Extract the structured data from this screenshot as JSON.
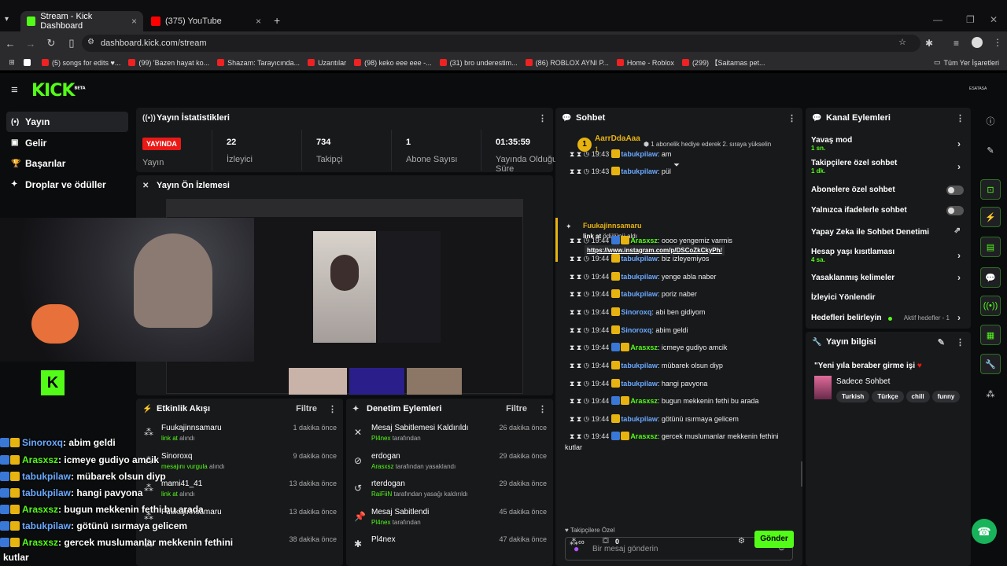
{
  "browser": {
    "tabs": [
      {
        "label": "Stream - Kick Dashboard",
        "color": "#53fc18"
      },
      {
        "label": "(375) YouTube",
        "color": "#ff0000"
      }
    ],
    "url": "dashboard.kick.com/stream",
    "bookmarks": [
      "(5) songs for edits ♥...",
      "(99) 'Bazen hayat ko...",
      "Shazam: Tarayıcında...",
      "Uzantılar",
      "(98) keko eee eee -...",
      "(31) bro underestim...",
      "(86) ROBLOX AYNI P...",
      "Home - Roblox",
      "(299) 【Saitamas pet..."
    ],
    "all_bookmarks": "Tüm Yer İşaretleri"
  },
  "kick": {
    "logo": "KICK",
    "beta": "BETA",
    "avatar_label": "ESATASA"
  },
  "sidebar": {
    "items": [
      {
        "label": "Yayın",
        "icon": "(•)"
      },
      {
        "label": "Gelir",
        "icon": "▣"
      },
      {
        "label": "Başarılar",
        "icon": "🏆"
      },
      {
        "label": "Droplar ve ödüller",
        "icon": "✦"
      }
    ]
  },
  "stats": {
    "title": "Yayın İstatistikleri",
    "live_badge": "YAYINDA",
    "live_label": "Yayın",
    "items": [
      {
        "value": "22",
        "label": "İzleyici"
      },
      {
        "value": "734",
        "label": "Takipçi"
      },
      {
        "value": "1",
        "label": "Abone Sayısı"
      },
      {
        "value": "01:35:59",
        "label": "Yayında Olduğu Süre"
      }
    ]
  },
  "preview": {
    "title": "Yayın Ön İzlemesi"
  },
  "activity": {
    "title": "Etkinlik Akışı",
    "filter": "Filtre",
    "items": [
      {
        "name": "Fuukajinnsamaru",
        "action": "link at",
        "suffix": "alındı",
        "time": "1 dakika önce"
      },
      {
        "name": "Sinoroxq",
        "action": "mesajını vurgula",
        "suffix": "alındı",
        "time": "9 dakika önce"
      },
      {
        "name": "mami41_41",
        "action": "link at",
        "suffix": "alındı",
        "time": "13 dakika önce"
      },
      {
        "name": "Fuukajinnsamaru",
        "action": "",
        "suffix": "",
        "time": "13 dakika önce"
      },
      {
        "name": "",
        "action": "",
        "suffix": "",
        "time": "38 dakika önce"
      }
    ]
  },
  "moderation": {
    "title": "Denetim Eylemleri",
    "filter": "Filtre",
    "items": [
      {
        "name": "Mesaj Sabitlemesi Kaldırıldı",
        "by": "Pl4nex",
        "suffix": "tarafından",
        "time": "26 dakika önce",
        "icon": "✕"
      },
      {
        "name": "erdogan",
        "by": "Arasxsz",
        "suffix": "tarafından yasaklandı",
        "time": "29 dakika önce",
        "icon": "⊘"
      },
      {
        "name": "rterdogan",
        "by": "RaiFiiN",
        "suffix": "tarafından yasağı kaldırıldı",
        "time": "29 dakika önce",
        "icon": "↺"
      },
      {
        "name": "Mesaj Sabitlendi",
        "by": "Pl4nex",
        "suffix": "tarafından",
        "time": "45 dakika önce",
        "icon": "📌"
      },
      {
        "name": "Pl4nex",
        "by": "",
        "suffix": "",
        "time": "47 dakika önce",
        "icon": "✱"
      }
    ]
  },
  "chat": {
    "title": "Sohbet",
    "gifter": {
      "name": "AarrDdaAaa",
      "count": "1",
      "rank": "1"
    },
    "gift_text": "1 abonelik hediye ederek 2. sıraya yükselin",
    "pinned": {
      "user": "Fuukajinnsamaru",
      "text_bold": "link at",
      "text": "ödülünü aldı",
      "link": "https://www.instagram.com/p/DSCoZkCkyPh/"
    },
    "messages": [
      {
        "time": "19:43",
        "user": "tabukpilaw",
        "color": "#6aa9ff",
        "text": "am"
      },
      {
        "time": "19:43",
        "user": "tabukpilaw",
        "color": "#6aa9ff",
        "text": "pül"
      },
      {
        "time": "19:44",
        "user": "Arasxsz",
        "color": "#53fc18",
        "text": "oooo yengemiz varmis"
      },
      {
        "time": "19:44",
        "user": "tabukpilaw",
        "color": "#6aa9ff",
        "text": "biz izleyemiyos"
      },
      {
        "time": "19:44",
        "user": "tabukpilaw",
        "color": "#6aa9ff",
        "text": "yenge abla naber"
      },
      {
        "time": "19:44",
        "user": "tabukpilaw",
        "color": "#6aa9ff",
        "text": "poriz naber"
      },
      {
        "time": "19:44",
        "user": "Sinoroxq",
        "color": "#6aa9ff",
        "text": "abi ben gidiyom"
      },
      {
        "time": "19:44",
        "user": "Sinoroxq",
        "color": "#6aa9ff",
        "text": "abim geldi"
      },
      {
        "time": "19:44",
        "user": "Arasxsz",
        "color": "#53fc18",
        "text": "icmeye gudiyo amcik"
      },
      {
        "time": "19:44",
        "user": "tabukpilaw",
        "color": "#6aa9ff",
        "text": "mübarek olsun diyp"
      },
      {
        "time": "19:44",
        "user": "tabukpilaw",
        "color": "#6aa9ff",
        "text": "hangi pavyona"
      },
      {
        "time": "19:44",
        "user": "Arasxsz",
        "color": "#53fc18",
        "text": "bugun mekkenin fethi bu arada"
      },
      {
        "time": "19:44",
        "user": "tabukpilaw",
        "color": "#6aa9ff",
        "text": "götünü ısırmaya gelicem"
      },
      {
        "time": "19:44",
        "user": "Arasxsz",
        "color": "#53fc18",
        "text": "gercek muslumanlar mekkenin fethini kutlar"
      }
    ],
    "followers_only": "Takipçilere Özel",
    "input_placeholder": "Bir mesaj gönderin",
    "points": "0",
    "send": "Gönder"
  },
  "channel_actions": {
    "title": "Kanal Eylemleri",
    "items": [
      {
        "label": "Yavaş mod",
        "sub": "1 sn.",
        "control": "chevron"
      },
      {
        "label": "Takipçilere özel sohbet",
        "sub": "1 dk.",
        "control": "chevron"
      },
      {
        "label": "Abonelere özel sohbet",
        "sub": "",
        "control": "toggle"
      },
      {
        "label": "Yalnızca ifadelerle sohbet",
        "sub": "",
        "control": "toggle"
      },
      {
        "label": "Yapay Zeka ile Sohbet Denetimi",
        "sub": "",
        "control": "external"
      },
      {
        "label": "Hesap yaşı kısıtlaması",
        "sub": "4 sa.",
        "control": "chevron"
      },
      {
        "label": "Yasaklanmış kelimeler",
        "sub": "",
        "control": "chevron"
      },
      {
        "label": "İzleyici Yönlendir",
        "sub": "",
        "control": "none"
      },
      {
        "label": "Hedefleri belirleyin",
        "sub": "",
        "control": "chevron"
      }
    ],
    "goals_status": "Aktif hedefler - 1"
  },
  "stream_info": {
    "title": "Yayın bilgisi",
    "stream_title": "\"Yeni yıla beraber girme işi",
    "category": "Sadece Sohbet",
    "tags": [
      "Turkish",
      "Türkçe",
      "chill",
      "funny"
    ]
  },
  "overlay": {
    "messages": [
      {
        "user": "Sinoroxq",
        "text": ": abim geldi",
        "style": "b"
      },
      {
        "user": "Arasxsz",
        "text": ": icmeye gudiyo amcik",
        "style": "g"
      },
      {
        "user": "tabukpilaw",
        "text": ": mübarek olsun diyp",
        "style": "b"
      },
      {
        "user": "tabukpilaw",
        "text": ": hangi pavyona",
        "style": "b"
      },
      {
        "user": "Arasxsz",
        "text": ": bugun mekkenin fethi bu arada",
        "style": "g"
      },
      {
        "user": "tabukpilaw",
        "text": ": götünü ısırmaya gelicem",
        "style": "b"
      },
      {
        "user": "Arasxsz",
        "text": ": gercek muslumanlar mekkenin fethini",
        "style": "g"
      }
    ],
    "wrap": "kutlar"
  },
  "colors": {
    "accent": "#53fc18",
    "panel": "#18191b",
    "bg": "#0b0c0d"
  }
}
